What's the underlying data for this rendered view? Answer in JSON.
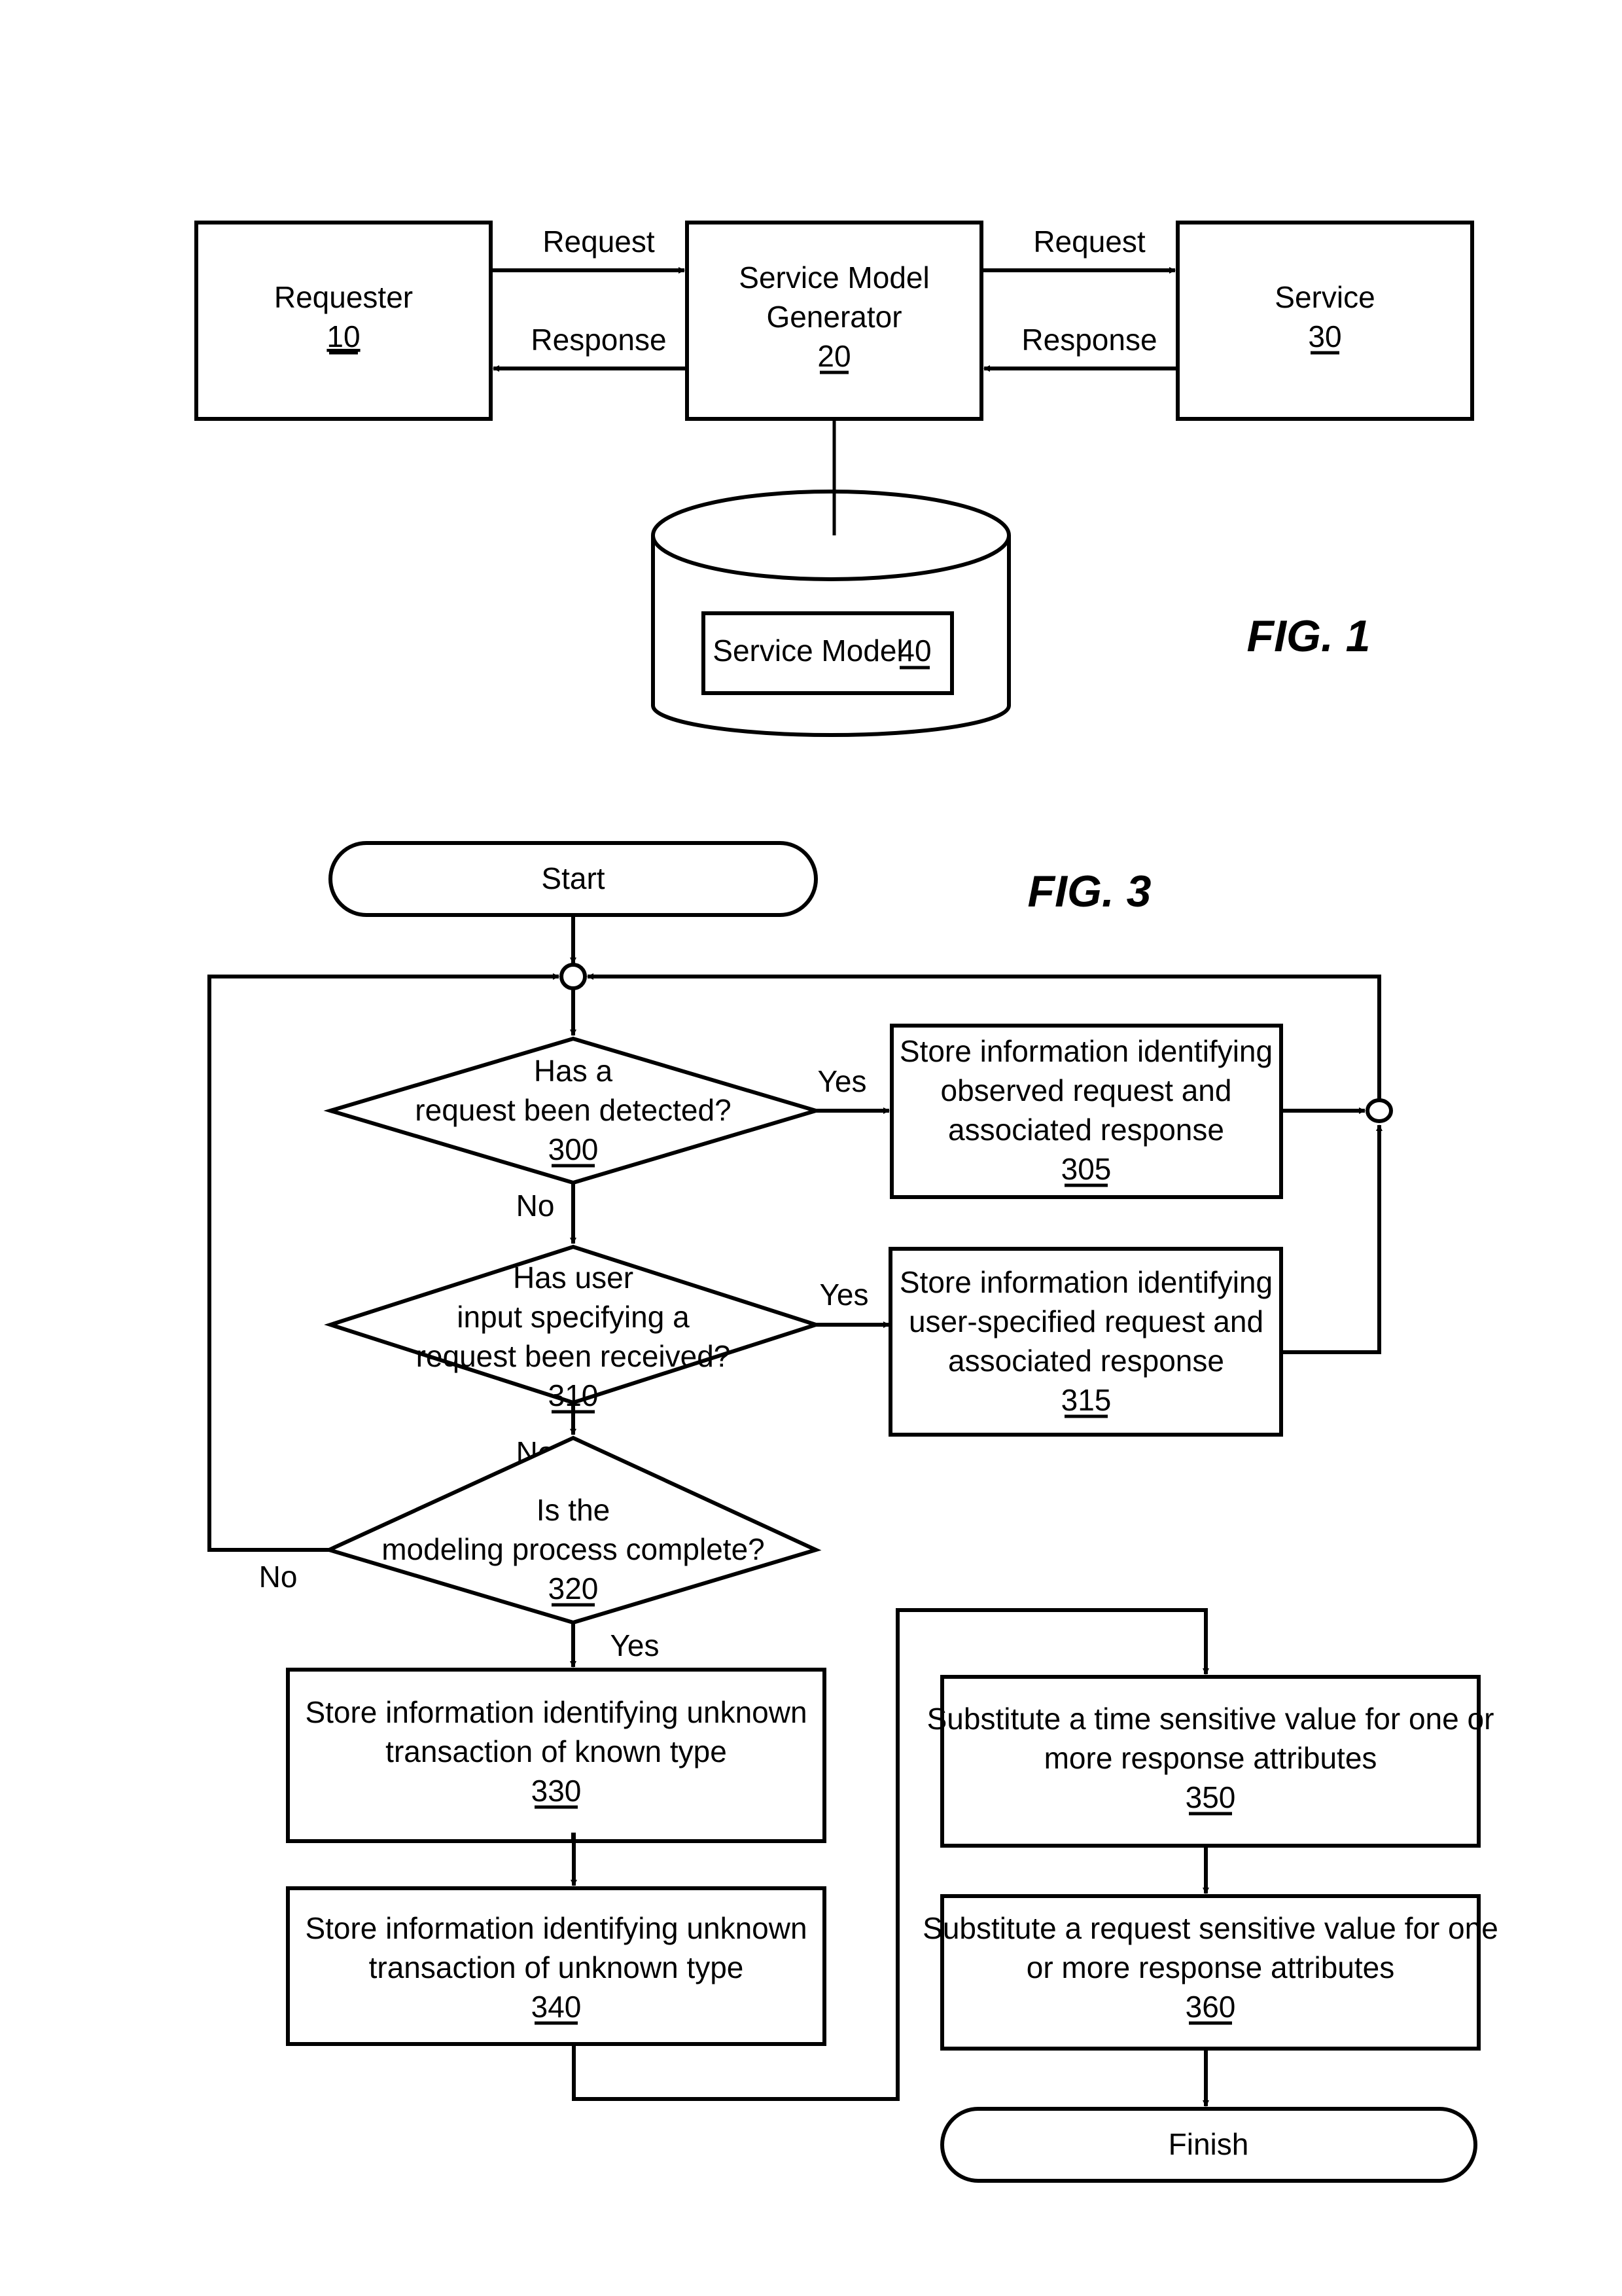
{
  "fig1": {
    "caption": "FIG. 1",
    "requester": {
      "label": "Requester",
      "ref": "10"
    },
    "generator": {
      "label_line1": "Service Model",
      "label_line2": "Generator",
      "ref": "20"
    },
    "service": {
      "label": "Service",
      "ref": "30"
    },
    "model_db": {
      "label": "Service Model",
      "ref": "40"
    },
    "edges": {
      "req_left": "Request",
      "resp_left": "Response",
      "req_right": "Request",
      "resp_right": "Response"
    }
  },
  "fig3": {
    "caption": "FIG. 3",
    "start": "Start",
    "finish": "Finish",
    "d300": {
      "lines": [
        "Has a",
        "request been detected?"
      ],
      "ref": "300"
    },
    "d310": {
      "lines": [
        "Has user",
        "input specifying a",
        "request been received?"
      ],
      "ref": "310"
    },
    "d320": {
      "lines": [
        "Is the",
        "modeling process complete?"
      ],
      "ref": "320"
    },
    "b305": {
      "lines": [
        "Store information identifying",
        "observed request and",
        "associated response"
      ],
      "ref": "305"
    },
    "b315": {
      "lines": [
        "Store information identifying",
        "user-specified request and",
        "associated response"
      ],
      "ref": "315"
    },
    "b330": {
      "lines": [
        "Store information identifying unknown",
        "transaction of known type"
      ],
      "ref": "330"
    },
    "b340": {
      "lines": [
        "Store information identifying unknown",
        "transaction of unknown type"
      ],
      "ref": "340"
    },
    "b350": {
      "lines": [
        "Substitute a time sensitive value for one or",
        "more response attributes"
      ],
      "ref": "350"
    },
    "b360": {
      "lines": [
        "Substitute a request sensitive value for one",
        "or more response attributes"
      ],
      "ref": "360"
    },
    "edge_labels": {
      "yes_300": "Yes",
      "no_300": "No",
      "yes_310": "Yes",
      "no_310": "No",
      "no_320": "No",
      "yes_320": "Yes"
    }
  }
}
